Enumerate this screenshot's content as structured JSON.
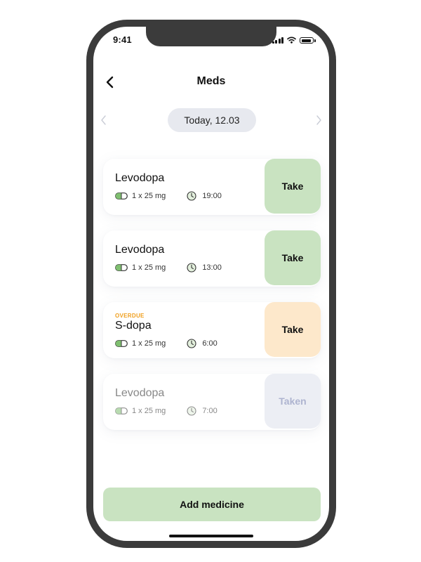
{
  "status_bar": {
    "time": "9:41"
  },
  "header": {
    "title": "Meds"
  },
  "date_nav": {
    "label": "Today, 12.03"
  },
  "meds": [
    {
      "name": "Levodopa",
      "dose": "1 x 25 mg",
      "time": "19:00",
      "action": "Take",
      "tag": ""
    },
    {
      "name": "Levodopa",
      "dose": "1 x 25 mg",
      "time": "13:00",
      "action": "Take",
      "tag": ""
    },
    {
      "name": "S-dopa",
      "dose": "1 x 25 mg",
      "time": "6:00",
      "action": "Take",
      "tag": "OVERDUE"
    },
    {
      "name": "Levodopa",
      "dose": "1 x 25 mg",
      "time": "7:00",
      "action": "Taken",
      "tag": ""
    }
  ],
  "footer": {
    "add_label": "Add medicine"
  },
  "colors": {
    "take_green": "#c9e3c1",
    "overdue_orange": "#fde8cb",
    "overdue_text": "#f0a020",
    "taken_gray": "#eceef4",
    "taken_text": "#aeb4d0",
    "date_pill": "#e7e9ef"
  },
  "icons": {
    "back": "chevron-left-icon",
    "prev_day": "chevron-left-icon",
    "next_day": "chevron-right-icon",
    "dose": "pill-icon",
    "time": "clock-icon"
  }
}
